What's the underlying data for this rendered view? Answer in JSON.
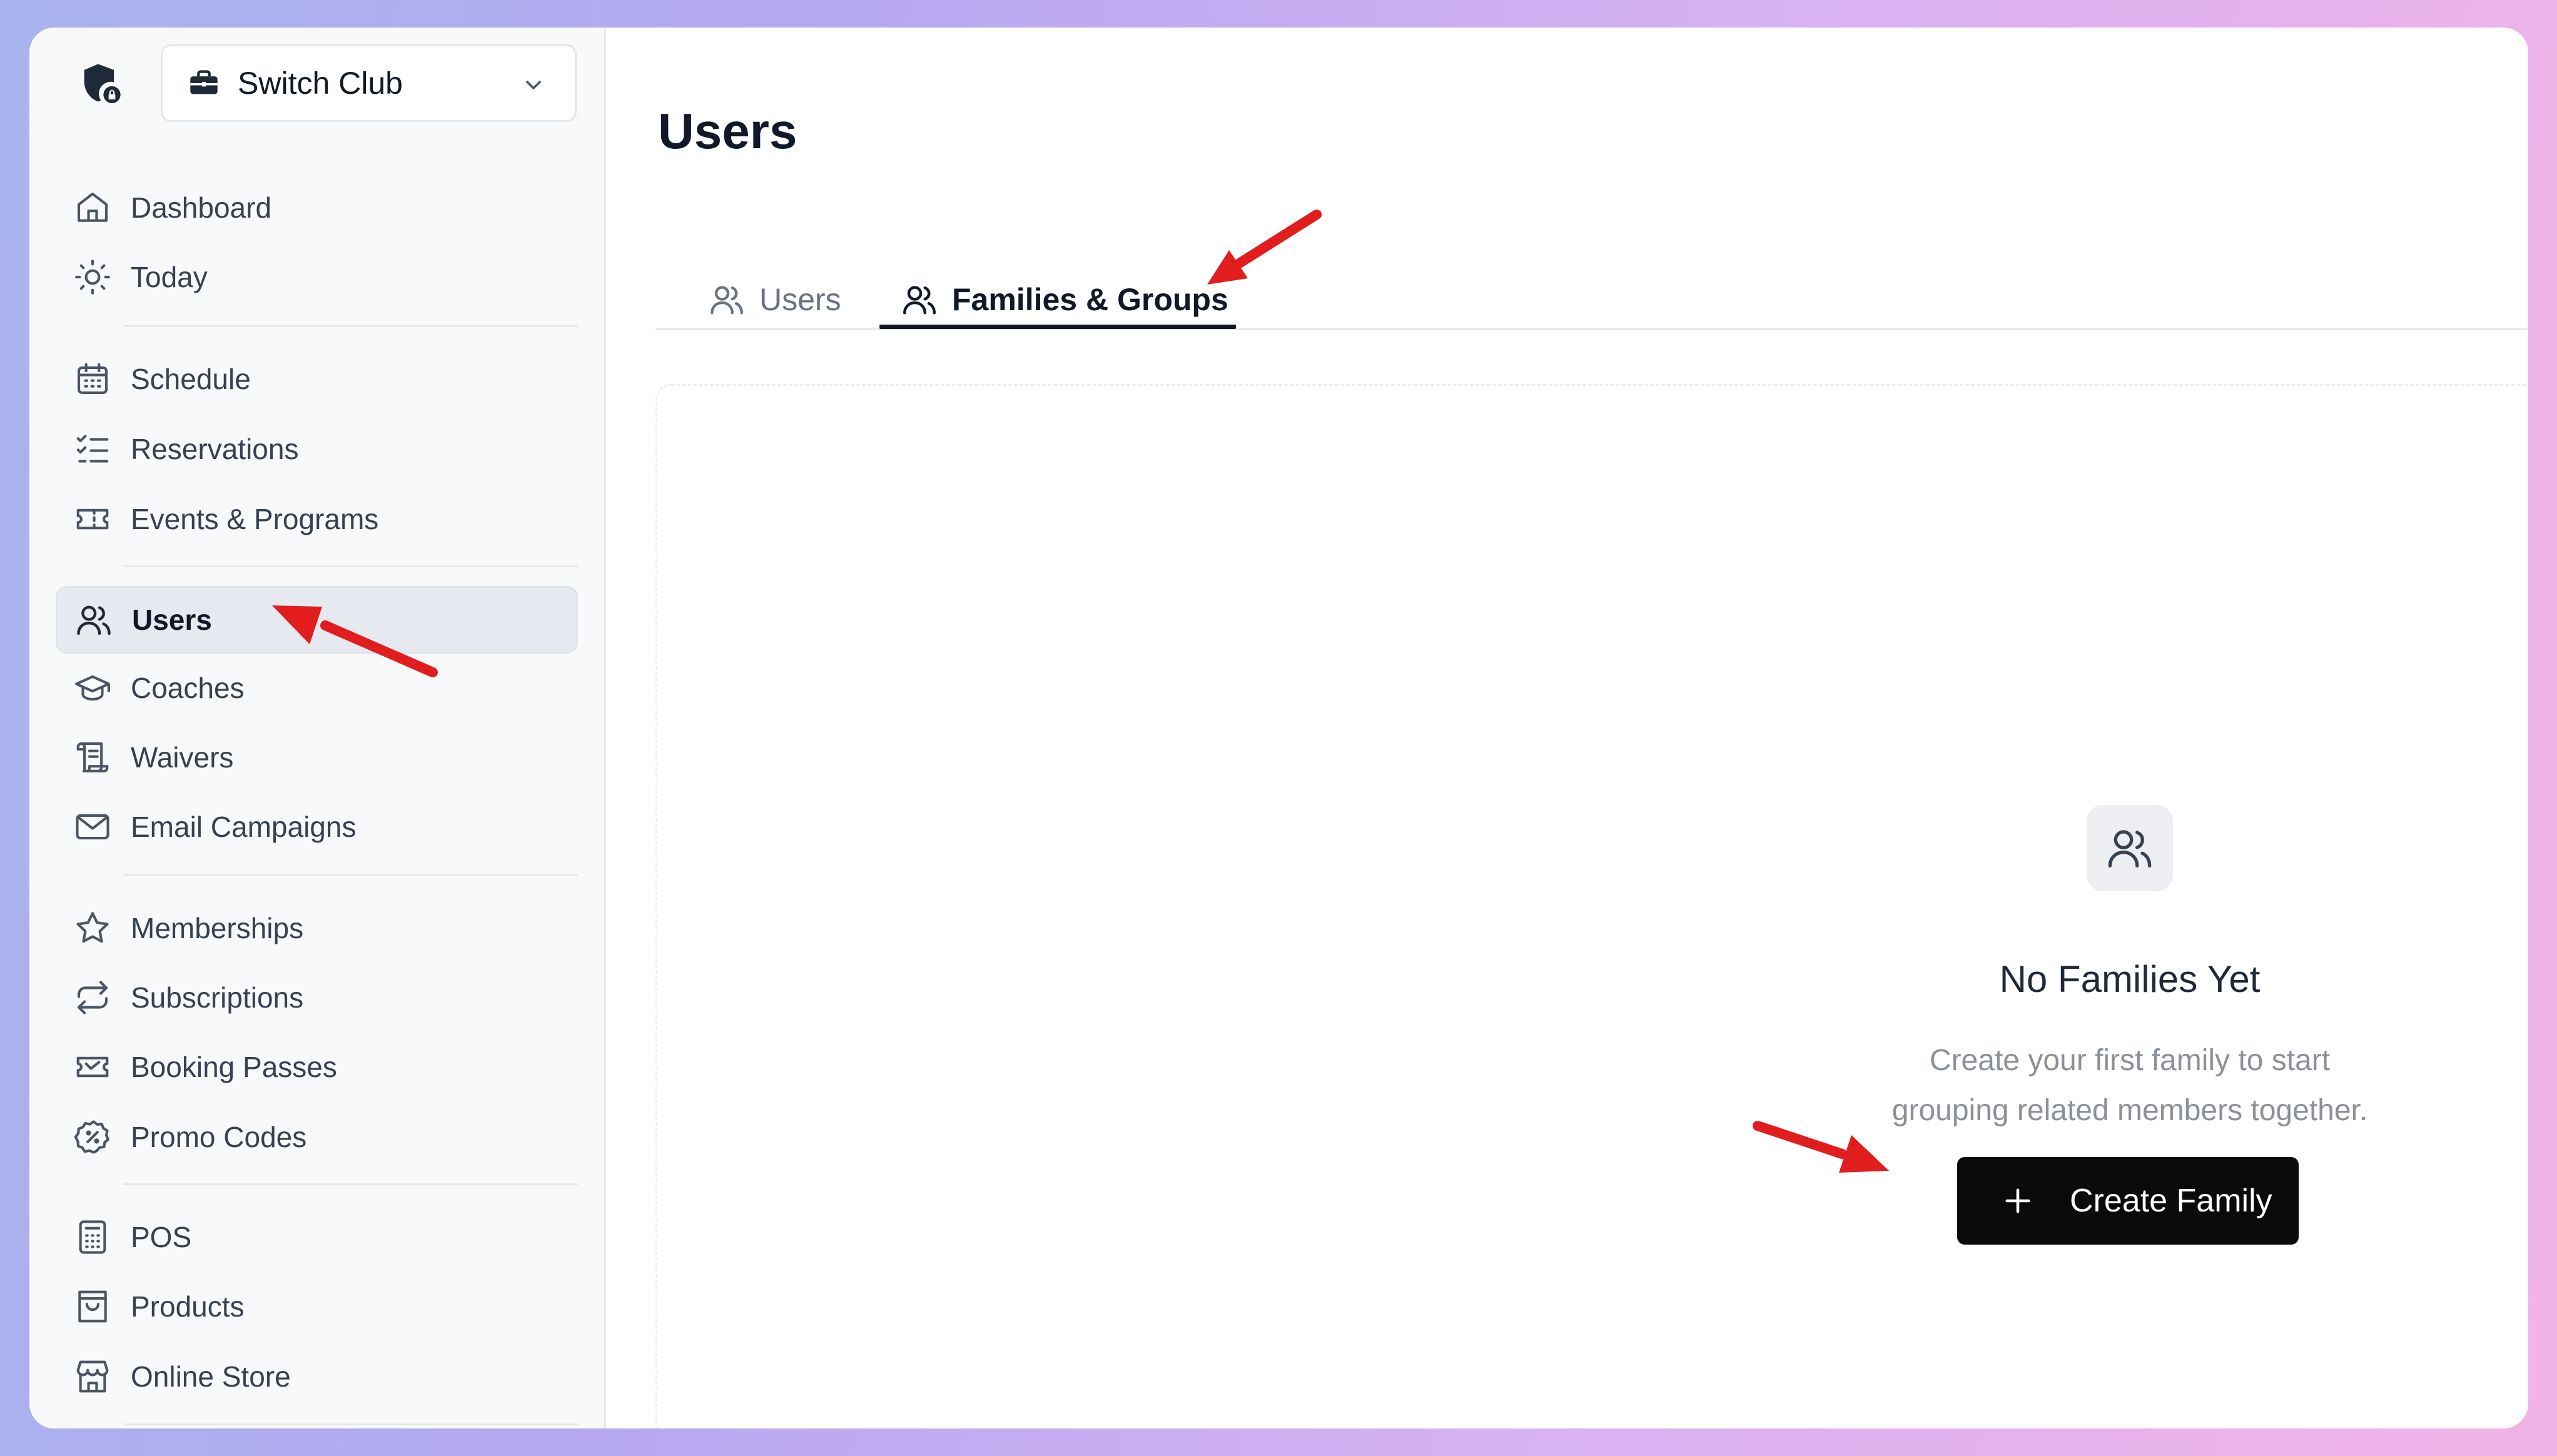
{
  "sidebar": {
    "club_selector": {
      "label": "Switch Club"
    },
    "groups": [
      [
        {
          "label": "Dashboard",
          "icon": "home-icon"
        },
        {
          "label": "Today",
          "icon": "sun-icon"
        }
      ],
      [
        {
          "label": "Schedule",
          "icon": "calendar-icon"
        },
        {
          "label": "Reservations",
          "icon": "list-check-icon"
        },
        {
          "label": "Events & Programs",
          "icon": "ticket-icon"
        }
      ],
      [
        {
          "label": "Users",
          "icon": "users-icon",
          "active": true
        },
        {
          "label": "Coaches",
          "icon": "graduation-cap-icon"
        },
        {
          "label": "Waivers",
          "icon": "scroll-icon"
        },
        {
          "label": "Email Campaigns",
          "icon": "mail-icon"
        }
      ],
      [
        {
          "label": "Memberships",
          "icon": "star-icon"
        },
        {
          "label": "Subscriptions",
          "icon": "repeat-icon"
        },
        {
          "label": "Booking Passes",
          "icon": "pass-icon"
        },
        {
          "label": "Promo Codes",
          "icon": "discount-badge-icon"
        }
      ],
      [
        {
          "label": "POS",
          "icon": "calculator-icon"
        },
        {
          "label": "Products",
          "icon": "shopping-bag-icon"
        },
        {
          "label": "Online Store",
          "icon": "store-icon"
        }
      ]
    ]
  },
  "main": {
    "title": "Users",
    "tabs": [
      {
        "label": "Users",
        "active": false
      },
      {
        "label": "Families & Groups",
        "active": true
      }
    ],
    "empty_state": {
      "title": "No Families Yet",
      "description_line1": "Create your first family to start",
      "description_line2": "grouping related members together.",
      "button_label": "Create Family"
    }
  },
  "colors": {
    "accent": "#0a0a0a",
    "annotation_arrow": "#e11d1d",
    "sidebar_bg": "#f8f9fb",
    "active_item_bg": "#e6e9ef"
  }
}
